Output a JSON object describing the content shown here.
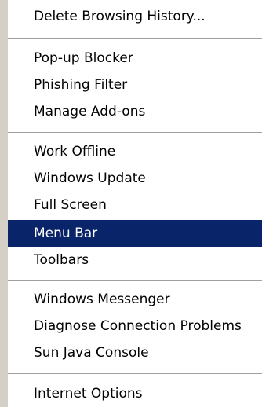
{
  "menu": {
    "items": [
      {
        "label": "Delete Browsing History...",
        "highlighted": false
      },
      {
        "label": "Pop-up Blocker",
        "highlighted": false
      },
      {
        "label": "Phishing Filter",
        "highlighted": false
      },
      {
        "label": "Manage Add-ons",
        "highlighted": false
      },
      {
        "label": "Work Offline",
        "highlighted": false
      },
      {
        "label": "Windows Update",
        "highlighted": false
      },
      {
        "label": "Full Screen",
        "highlighted": false
      },
      {
        "label": "Menu Bar",
        "highlighted": true
      },
      {
        "label": "Toolbars",
        "highlighted": false
      },
      {
        "label": "Windows Messenger",
        "highlighted": false
      },
      {
        "label": "Diagnose Connection Problems",
        "highlighted": false
      },
      {
        "label": "Sun Java Console",
        "highlighted": false
      },
      {
        "label": "Internet Options",
        "highlighted": false
      }
    ]
  },
  "colors": {
    "menu_background": "#ffffff",
    "left_strip": "#d4d0c8",
    "highlight_background": "#0a246a",
    "highlight_text": "#ffffff",
    "separator": "#a0a0a0"
  }
}
